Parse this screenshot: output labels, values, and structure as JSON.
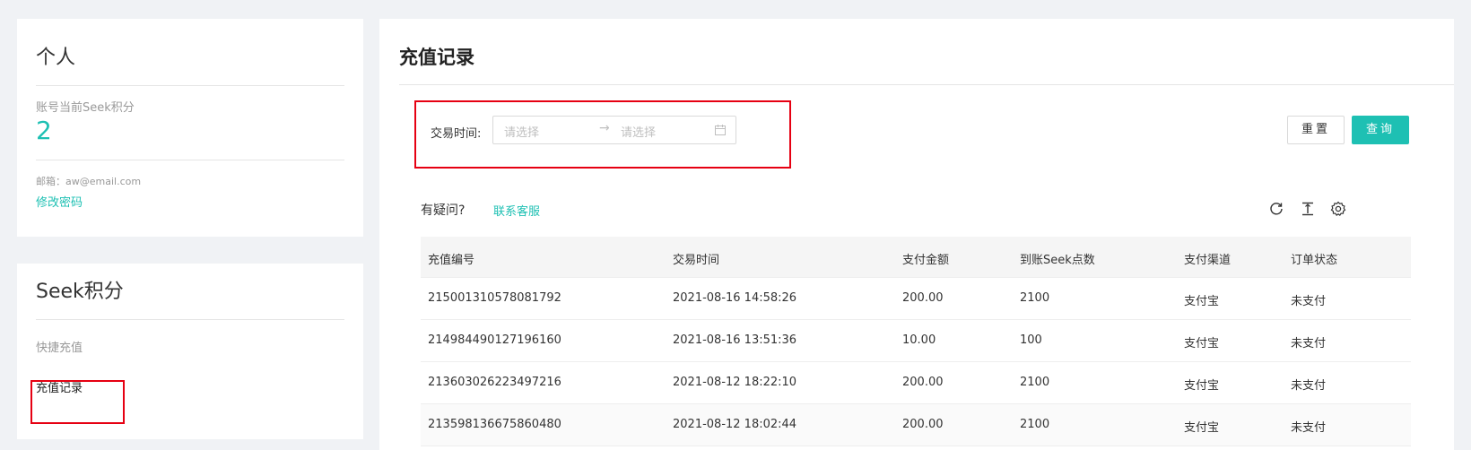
{
  "profile": {
    "title": "个人",
    "points_label": "账号当前Seek积分",
    "points_value": "2",
    "email_label": "邮箱：",
    "email_value": "aw@email.com",
    "change_password": "修改密码"
  },
  "seek": {
    "title": "Seek积分",
    "items": [
      {
        "label": "快捷充值"
      },
      {
        "label": "充值记录"
      }
    ]
  },
  "main": {
    "title": "充值记录",
    "filter": {
      "label": "交易时间:",
      "start_placeholder": "请选择",
      "end_placeholder": "请选择",
      "arrow": "→"
    },
    "buttons": {
      "reset": "重置",
      "query": "查询"
    },
    "question": "有疑问?",
    "contact": "联系客服",
    "tools": [
      "reload-icon",
      "density-icon",
      "settings-icon"
    ],
    "table": {
      "columns": [
        "充值编号",
        "交易时间",
        "支付金额",
        "到账Seek点数",
        "支付渠道",
        "订单状态"
      ],
      "rows": [
        [
          "215001310578081792",
          "2021-08-16 14:58:26",
          "200.00",
          "2100",
          "支付宝",
          "未支付"
        ],
        [
          "214984490127196160",
          "2021-08-16 13:51:36",
          "10.00",
          "100",
          "支付宝",
          "未支付"
        ],
        [
          "213603026223497216",
          "2021-08-12 18:22:10",
          "200.00",
          "2100",
          "支付宝",
          "未支付"
        ],
        [
          "213598136675860480",
          "2021-08-12 18:02:44",
          "200.00",
          "2100",
          "支付宝",
          "未支付"
        ]
      ]
    }
  },
  "colors": {
    "accent": "#1ec0b3",
    "annotation": "#e60012"
  }
}
